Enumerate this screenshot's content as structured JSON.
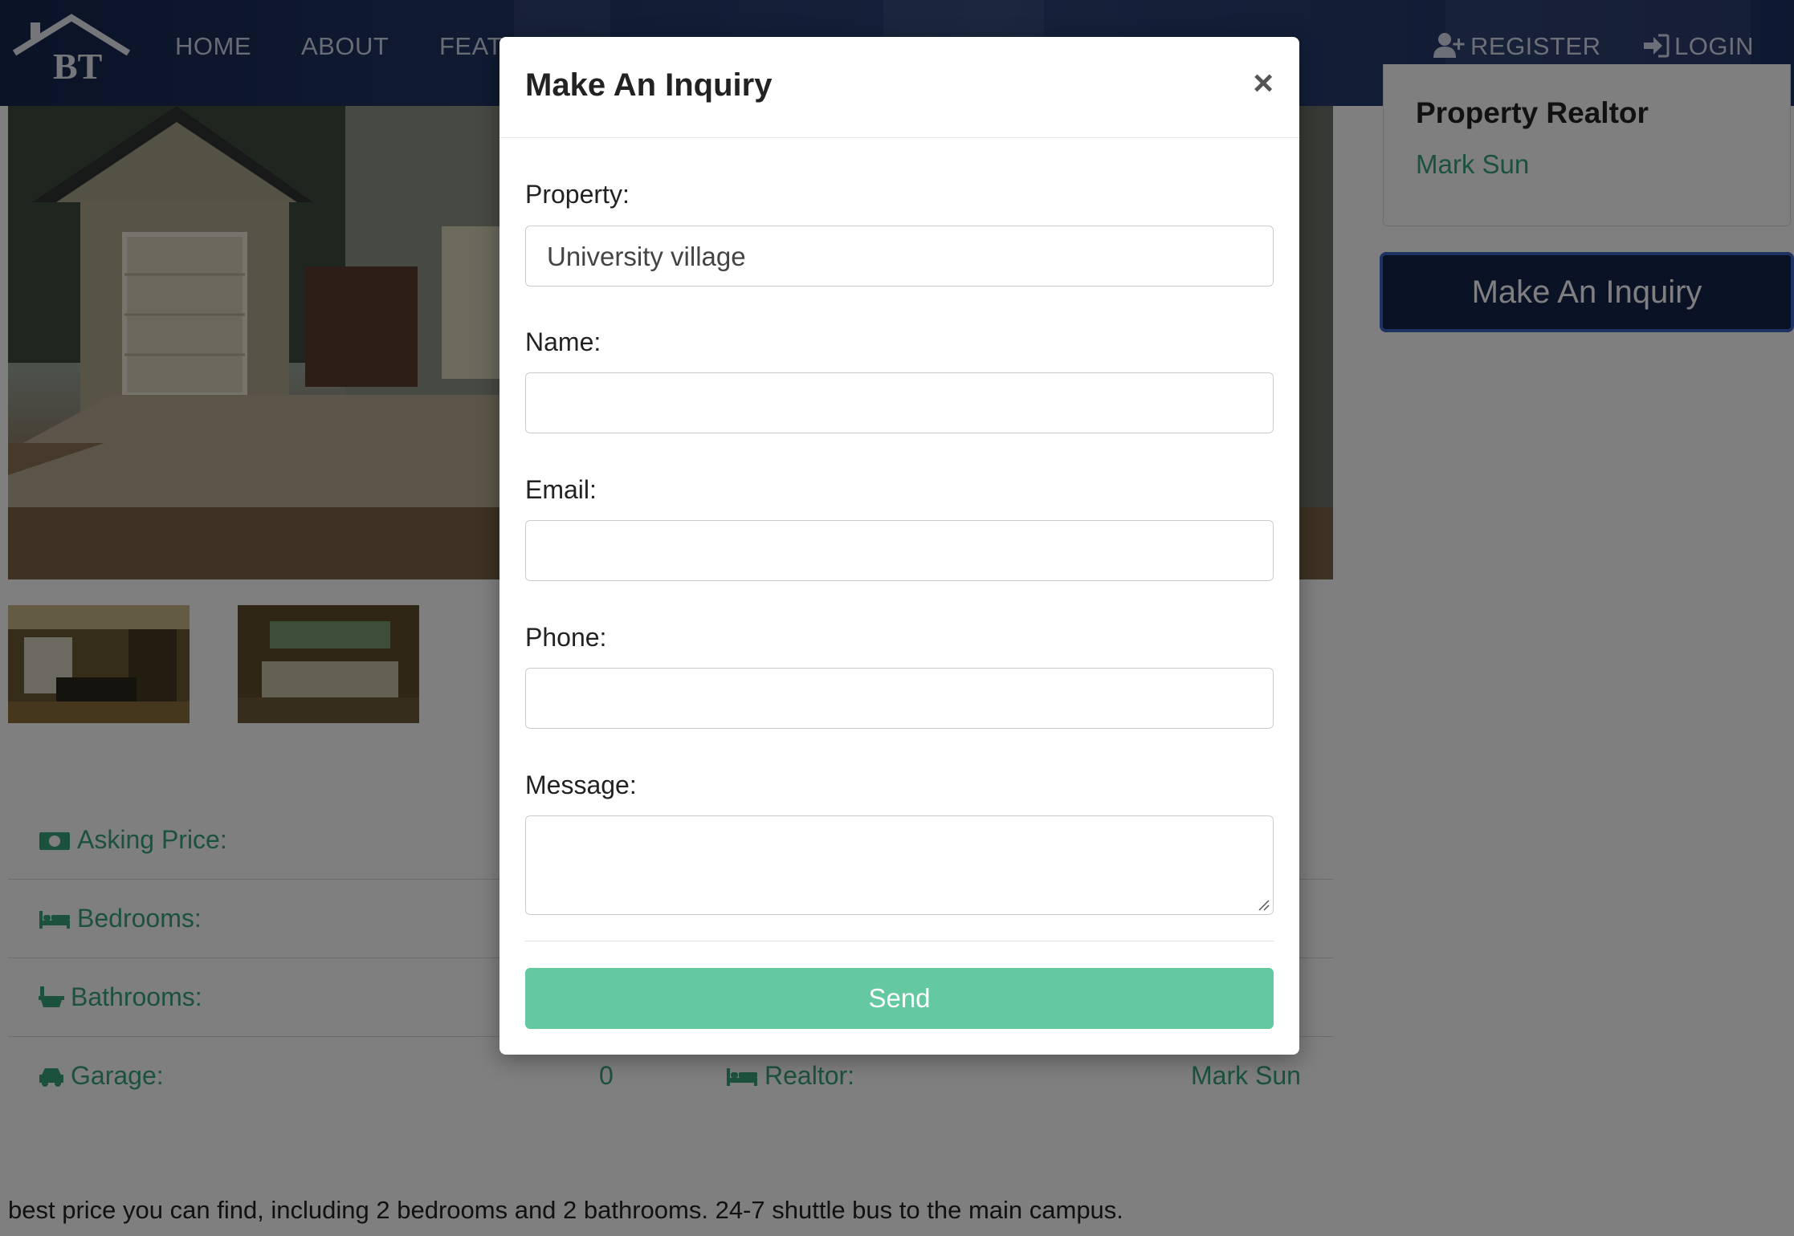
{
  "nav": {
    "logo_text": "BT",
    "links": [
      "HOME",
      "ABOUT",
      "FEATURED"
    ],
    "register": "REGISTER",
    "login": "LOGIN"
  },
  "sidebar": {
    "realtor_title": "Property Realtor",
    "realtor_name": "Mark Sun",
    "inquiry_button": "Make An Inquiry"
  },
  "details": {
    "asking_price_label": "Asking Price:",
    "bedrooms_label": "Bedrooms:",
    "bathrooms_label": "Bathrooms:",
    "garage_label": "Garage:",
    "garage_value": "0",
    "realtor_label": "Realtor:",
    "realtor_value": "Mark Sun"
  },
  "description": "best price you can find, including 2 bedrooms and 2 bathrooms. 24-7 shuttle bus to the main campus.",
  "modal": {
    "title": "Make An Inquiry",
    "close": "×",
    "property_label": "Property:",
    "property_value": "University village",
    "name_label": "Name:",
    "email_label": "Email:",
    "phone_label": "Phone:",
    "message_label": "Message:",
    "send_button": "Send"
  },
  "colors": {
    "accent_green": "#38a47a",
    "send_button": "#64c8a1",
    "navbar": "#1d3163",
    "inquiry_button": "#14244d"
  }
}
